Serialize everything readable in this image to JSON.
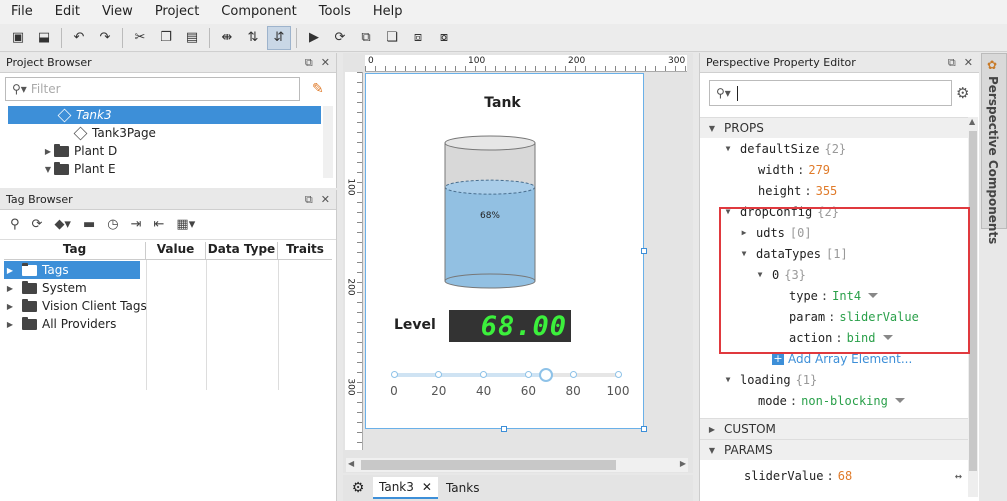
{
  "menubar": {
    "items": [
      "File",
      "Edit",
      "View",
      "Project",
      "Component",
      "Tools",
      "Help"
    ]
  },
  "project_browser": {
    "title": "Project Browser",
    "filter_placeholder": "Filter",
    "items": [
      {
        "label": "Tank3",
        "selected": true
      },
      {
        "label": "Tank3Page"
      },
      {
        "label": "Plant D"
      },
      {
        "label": "Plant E"
      }
    ]
  },
  "tag_browser": {
    "title": "Tag Browser",
    "columns": [
      "Tag",
      "Value",
      "Data Type",
      "Traits"
    ],
    "items": [
      "Tags",
      "System",
      "Vision Client Tags",
      "All Providers"
    ]
  },
  "canvas": {
    "ruler_top": [
      "0",
      "100",
      "200",
      "300"
    ],
    "ruler_left": [
      "100",
      "200",
      "300"
    ],
    "tank_title": "Tank",
    "tank_percent": "68%",
    "tank_level_fraction": 0.68,
    "level_label": "Level",
    "led_value": "68.00",
    "slider_ticks": [
      "0",
      "20",
      "40",
      "60",
      "80",
      "100"
    ],
    "slider_value": 68,
    "tabs": [
      "Tank3",
      "Tanks"
    ]
  },
  "property_editor": {
    "title": "Perspective Property Editor",
    "props_header": "PROPS",
    "rows": {
      "defaultSize": {
        "key": "defaultSize",
        "count": "{2}"
      },
      "width": {
        "key": "width",
        "value": "279"
      },
      "height": {
        "key": "height",
        "value": "355"
      },
      "dropConfig": {
        "key": "dropConfig",
        "count": "{2}"
      },
      "udts": {
        "key": "udts",
        "count": "[0]"
      },
      "dataTypes": {
        "key": "dataTypes",
        "count": "[1]"
      },
      "zero": {
        "key": "0",
        "count": "{3}"
      },
      "type": {
        "key": "type",
        "value": "Int4"
      },
      "param": {
        "key": "param",
        "value": "sliderValue"
      },
      "action": {
        "key": "action",
        "value": "bind"
      },
      "add_array": "Add Array Element...",
      "loading": {
        "key": "loading",
        "count": "{1}"
      },
      "mode": {
        "key": "mode",
        "value": "non-blocking"
      }
    },
    "custom_header": "CUSTOM",
    "params_header": "PARAMS",
    "param_row": {
      "key": "sliderValue",
      "value": "68"
    }
  },
  "side_tab": "Perspective Components",
  "colors": {
    "accent": "#3d8fd8",
    "highlight_box": "#e0393e",
    "led": "#3cf03c"
  }
}
